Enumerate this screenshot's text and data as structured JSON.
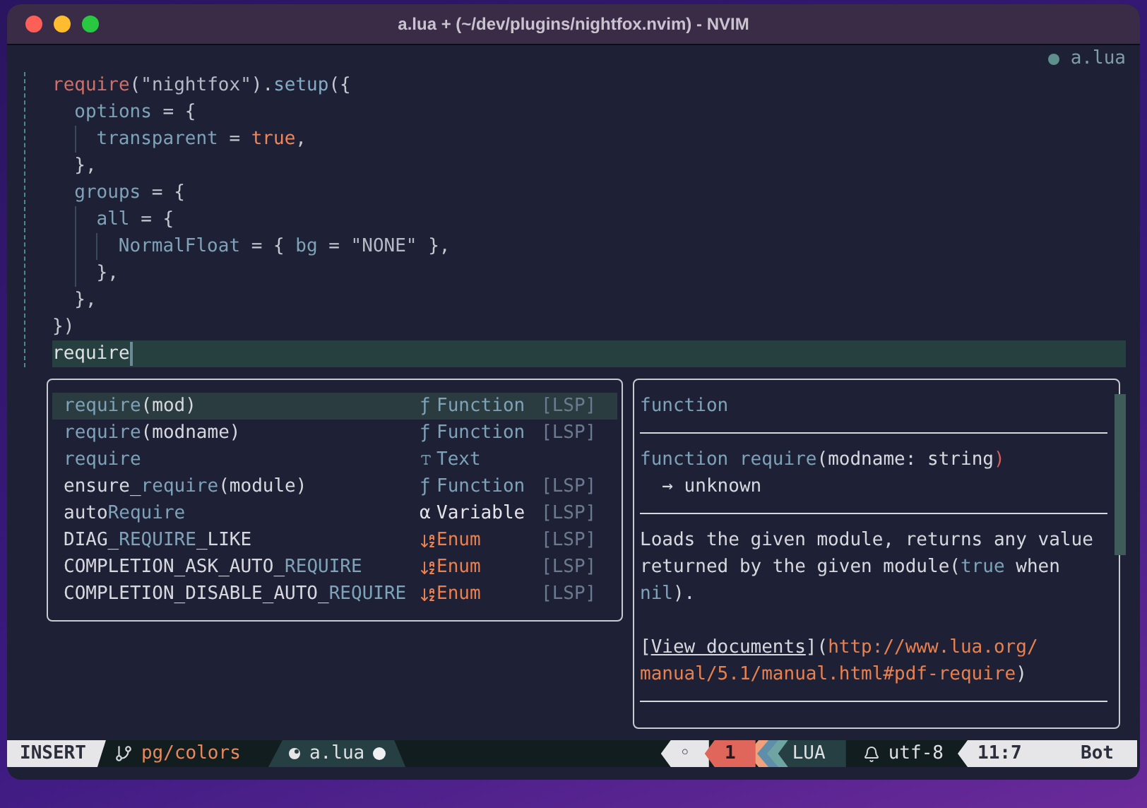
{
  "window": {
    "title": "a.lua + (~/dev/plugins/nightfox.nvim) - NVIM"
  },
  "winbar": {
    "file": "a.lua"
  },
  "code_lines": [
    {
      "tokens": [
        {
          "text": "require",
          "kind": "builtin"
        },
        {
          "text": "(",
          "kind": "punct"
        },
        {
          "text": "\"nightfox\"",
          "kind": "string"
        },
        {
          "text": ").",
          "kind": "punct"
        },
        {
          "text": "setup",
          "kind": "method"
        },
        {
          "text": "({",
          "kind": "punct"
        }
      ]
    },
    {
      "tokens": [
        {
          "text": "  options",
          "kind": "field"
        },
        {
          "text": " = {",
          "kind": "punct"
        }
      ]
    },
    {
      "tokens": [
        {
          "text": "    transparent",
          "kind": "field"
        },
        {
          "text": " = ",
          "kind": "punct"
        },
        {
          "text": "true",
          "kind": "boolean"
        },
        {
          "text": ",",
          "kind": "punct"
        }
      ]
    },
    {
      "tokens": [
        {
          "text": "  },",
          "kind": "punct"
        }
      ]
    },
    {
      "tokens": [
        {
          "text": "  groups",
          "kind": "field"
        },
        {
          "text": " = {",
          "kind": "punct"
        }
      ]
    },
    {
      "tokens": [
        {
          "text": "    all",
          "kind": "field"
        },
        {
          "text": " = {",
          "kind": "punct"
        }
      ]
    },
    {
      "tokens": [
        {
          "text": "      NormalFloat",
          "kind": "field"
        },
        {
          "text": " = { ",
          "kind": "punct"
        },
        {
          "text": "bg",
          "kind": "field"
        },
        {
          "text": " = ",
          "kind": "punct"
        },
        {
          "text": "\"NONE\"",
          "kind": "string"
        },
        {
          "text": " },",
          "kind": "punct"
        }
      ]
    },
    {
      "tokens": [
        {
          "text": "    },",
          "kind": "punct"
        }
      ]
    },
    {
      "tokens": [
        {
          "text": "  },",
          "kind": "punct"
        }
      ]
    },
    {
      "tokens": [
        {
          "text": "})",
          "kind": "punct"
        }
      ]
    },
    {
      "tokens": [
        {
          "text": "require",
          "kind": "plain"
        }
      ],
      "current": true
    }
  ],
  "completion": {
    "items": [
      {
        "label": [
          {
            "text": "require",
            "match": true
          },
          {
            "text": "(mod)",
            "match": false
          }
        ],
        "icon": "ƒ",
        "kind_name": "Function",
        "kind": "function",
        "source": "[LSP]",
        "selected": true
      },
      {
        "label": [
          {
            "text": "require",
            "match": true
          },
          {
            "text": "(modname)",
            "match": false
          }
        ],
        "icon": "ƒ",
        "kind_name": "Function",
        "kind": "function",
        "source": "[LSP]",
        "selected": false
      },
      {
        "label": [
          {
            "text": "require",
            "match": true
          }
        ],
        "kind_name": "Text",
        "kind": "text",
        "selected": false
      },
      {
        "label": [
          {
            "text": "ensure_",
            "match": false
          },
          {
            "text": "require",
            "match": true
          },
          {
            "text": "(module)",
            "match": false
          }
        ],
        "icon": "ƒ",
        "kind_name": "Function",
        "kind": "function",
        "source": "[LSP]",
        "selected": false
      },
      {
        "label": [
          {
            "text": "auto",
            "match": false
          },
          {
            "text": "Require",
            "match": true
          }
        ],
        "icon": "α",
        "kind_name": "Variable",
        "kind": "variable",
        "source": "[LSP]",
        "selected": false
      },
      {
        "label": [
          {
            "text": "DIAG_",
            "match": false
          },
          {
            "text": "REQUIRE",
            "match": true
          },
          {
            "text": "_LIKE",
            "match": false
          }
        ],
        "kind_name": "Enum",
        "kind": "enum",
        "source": "[LSP]",
        "selected": false
      },
      {
        "label": [
          {
            "text": "COMPLETION_ASK_AUTO_",
            "match": false
          },
          {
            "text": "REQUIRE",
            "match": true
          }
        ],
        "kind_name": "Enum",
        "kind": "enum",
        "source": "[LSP]",
        "selected": false
      },
      {
        "label": [
          {
            "text": "COMPLETION_DISABLE_AUTO_",
            "match": false
          },
          {
            "text": "REQUIRE",
            "match": true
          }
        ],
        "kind_name": "Enum",
        "kind": "enum",
        "source": "[LSP]",
        "selected": false
      }
    ]
  },
  "documentation": {
    "blocks": [
      {
        "kind": "heading",
        "tokens": [
          {
            "text": "function",
            "kind": "keyword"
          }
        ]
      },
      {
        "kind": "rule"
      },
      {
        "kind": "code",
        "lines": [
          [
            {
              "text": "function ",
              "kind": "keyword"
            },
            {
              "text": "require",
              "kind": "keyword"
            },
            {
              "text": "(modname: string",
              "kind": "plain"
            },
            {
              "text": ")",
              "kind": "error"
            }
          ],
          [
            {
              "text": "  → unknown",
              "kind": "plain"
            }
          ]
        ]
      },
      {
        "kind": "rule"
      },
      {
        "kind": "paragraph",
        "tokens": [
          {
            "text": "Loads the given module, returns any value returned by the given module(",
            "kind": "plain"
          },
          {
            "text": "true",
            "kind": "keyword"
          },
          {
            "text": " when ",
            "kind": "plain"
          },
          {
            "text": "nil",
            "kind": "keyword"
          },
          {
            "text": ").",
            "kind": "plain"
          }
        ]
      },
      {
        "kind": "link",
        "tokens": [
          {
            "text": "[",
            "kind": "plain"
          },
          {
            "text": "View documents",
            "kind": "underline"
          },
          {
            "text": "](",
            "kind": "plain"
          },
          {
            "text": "http://www.lua.org/",
            "kind": "url"
          },
          {
            "text": "manual/5.1/manual.html#pdf-require",
            "kind": "url"
          },
          {
            "text": ")",
            "kind": "plain"
          }
        ]
      },
      {
        "kind": "rule"
      }
    ]
  },
  "statusline": {
    "left": [
      {
        "kind": "mode",
        "text": "INSERT"
      },
      {
        "kind": "branch",
        "text": "pg/colors"
      },
      {
        "kind": "file",
        "text": "a.lua",
        "modified": true
      }
    ],
    "right": [
      {
        "kind": "lsp",
        "text": "◦"
      },
      {
        "kind": "errors",
        "text": "1"
      },
      {
        "kind": "filetype",
        "text": "LUA"
      },
      {
        "kind": "encoding",
        "text": "utf-8"
      },
      {
        "kind": "position",
        "text": "11:7"
      },
      {
        "kind": "scroll",
        "text": "Bot"
      }
    ]
  }
}
